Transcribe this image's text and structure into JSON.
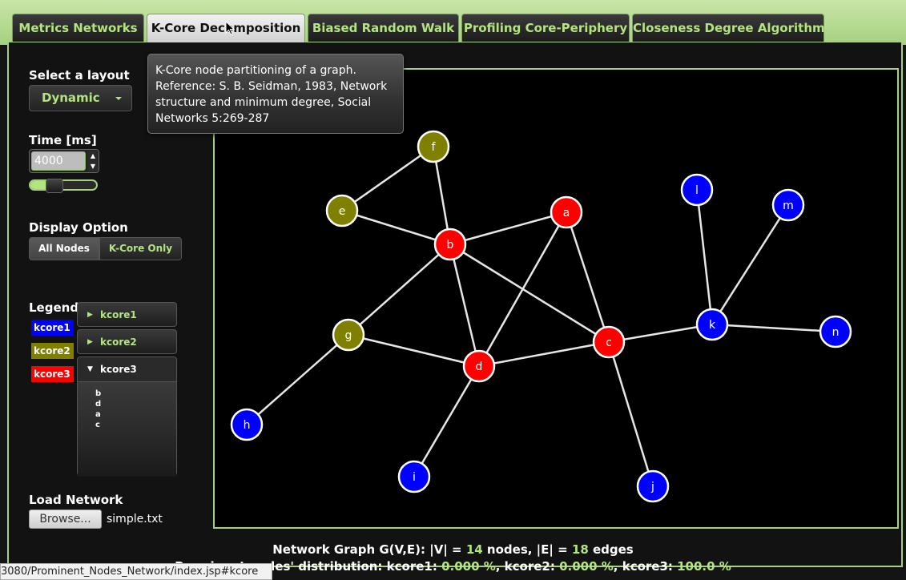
{
  "tabs": [
    {
      "label": "Metrics Networks"
    },
    {
      "label": "K-Core Decomposition"
    },
    {
      "label": "Biased Random Walk"
    },
    {
      "label": "Profiling Core-Periphery"
    },
    {
      "label": "Closeness Degree Algorithm"
    }
  ],
  "active_tab": "K-Core Decomposition",
  "sidebar": {
    "layout_label": "Select a layout",
    "layout_value": "Dynamic",
    "time_label": "Time [ms]",
    "time_value": "4000",
    "time_slider_fraction": 0.25,
    "display_label": "Display Option",
    "display_all": "All Nodes",
    "display_kcore": "K-Core Only",
    "legend_label": "Legend",
    "legend": [
      {
        "name": "kcore1",
        "color": "#0000ff"
      },
      {
        "name": "kcore2",
        "color": "#808000"
      },
      {
        "name": "kcore3",
        "color": "#ff0000"
      }
    ],
    "accordion": [
      {
        "title": "kcore1",
        "open": false
      },
      {
        "title": "kcore2",
        "open": false
      },
      {
        "title": "kcore3",
        "open": true,
        "items": [
          "b",
          "d",
          "a",
          "c"
        ]
      }
    ],
    "load_label": "Load Network",
    "browse_label": "Browse...",
    "file_name": "simple.txt"
  },
  "tooltip": {
    "lines": [
      "K-Core node partitioning of a graph.",
      "Reference: S. B. Seidman, 1983, Network",
      "structure and minimum degree, Social",
      "Networks 5:269-287"
    ]
  },
  "graph": {
    "nodes": [
      {
        "id": "a",
        "kcore": 3
      },
      {
        "id": "b",
        "kcore": 3
      },
      {
        "id": "c",
        "kcore": 3
      },
      {
        "id": "d",
        "kcore": 3
      },
      {
        "id": "e",
        "kcore": 2
      },
      {
        "id": "f",
        "kcore": 2
      },
      {
        "id": "g",
        "kcore": 2
      },
      {
        "id": "h",
        "kcore": 1
      },
      {
        "id": "i",
        "kcore": 1
      },
      {
        "id": "j",
        "kcore": 1
      },
      {
        "id": "k",
        "kcore": 1
      },
      {
        "id": "l",
        "kcore": 1
      },
      {
        "id": "m",
        "kcore": 1
      },
      {
        "id": "n",
        "kcore": 1
      }
    ],
    "edges": [
      [
        "e",
        "f"
      ],
      [
        "e",
        "b"
      ],
      [
        "f",
        "b"
      ],
      [
        "b",
        "a"
      ],
      [
        "b",
        "d"
      ],
      [
        "b",
        "c"
      ],
      [
        "b",
        "g"
      ],
      [
        "a",
        "d"
      ],
      [
        "a",
        "c"
      ],
      [
        "g",
        "d"
      ],
      [
        "g",
        "h"
      ],
      [
        "d",
        "c"
      ],
      [
        "d",
        "i"
      ],
      [
        "c",
        "j"
      ],
      [
        "c",
        "k"
      ],
      [
        "k",
        "l"
      ],
      [
        "k",
        "m"
      ],
      [
        "k",
        "n"
      ]
    ],
    "colors": {
      "kcore1": "#0000ff",
      "kcore2": "#808000",
      "kcore3": "#ff0000"
    }
  },
  "summary": {
    "line1_prefix": "Network Graph G(V,E): |V| = ",
    "nodes_count": "14",
    "line1_mid": " nodes, |E| = ",
    "edges_count": "18",
    "line1_suffix": " edges",
    "line2_prefix": "Prominent nodes' distribution: kcore1: ",
    "k1": "0.000 %",
    "l2a": ", kcore2: ",
    "k2": "0.000 %",
    "l2b": ", kcore3: ",
    "k3": "100.0 %"
  },
  "status_url": "3080/Prominent_Nodes_Network/index.jsp#kcore"
}
